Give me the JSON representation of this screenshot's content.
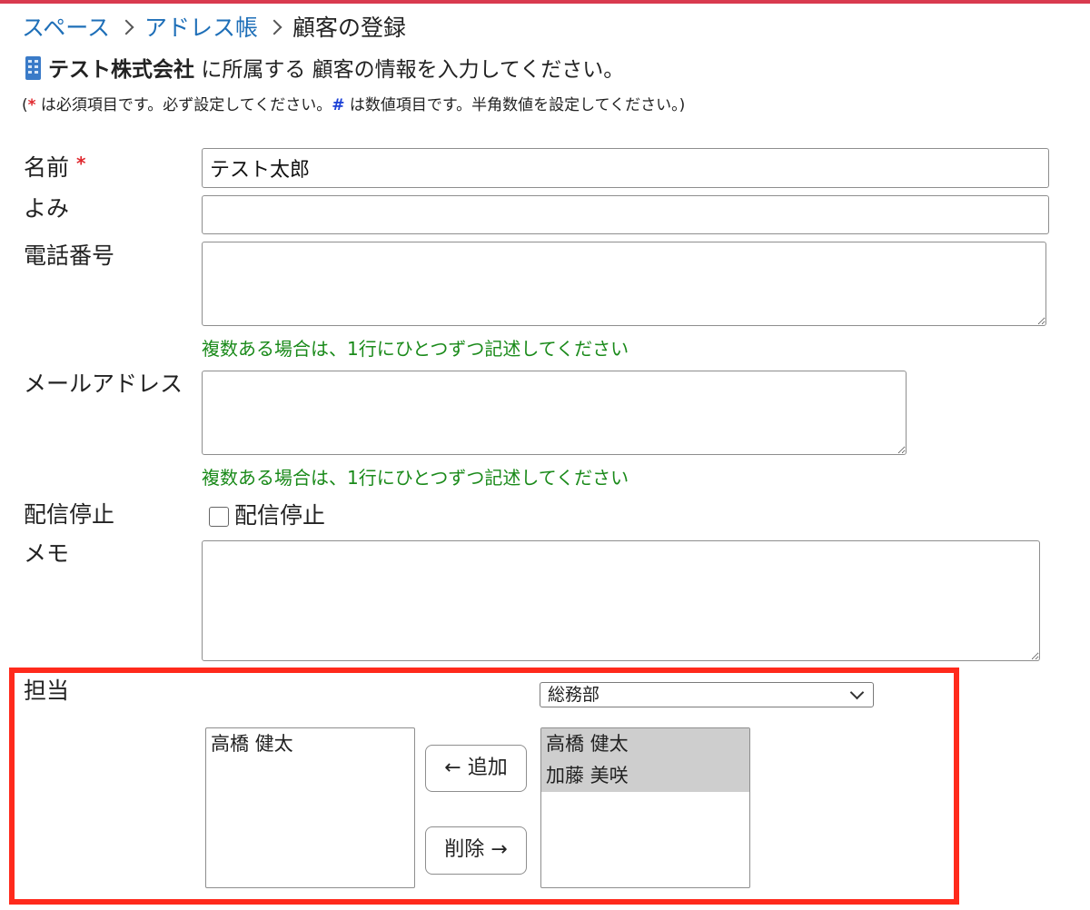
{
  "breadcrumb": {
    "items": [
      "スペース",
      "アドレス帳"
    ],
    "current": "顧客の登録"
  },
  "heading": {
    "company": "テスト株式会社",
    "text": "に所属する 顧客の情報を入力してください。"
  },
  "note": {
    "open": "(",
    "star": "*",
    "required_text": " は必須項目です。必ず設定してください。",
    "hash": "#",
    "numeric_text": " は数値項目です。半角数値を設定してください。)"
  },
  "form": {
    "name": {
      "label": "名前",
      "required_mark": "*",
      "value": "テスト太郎"
    },
    "yomi": {
      "label": "よみ",
      "value": ""
    },
    "phone": {
      "label": "電話番号",
      "value": "",
      "hint": "複数ある場合は、1行にひとつずつ記述してください"
    },
    "email": {
      "label": "メールアドレス",
      "value": "",
      "hint": "複数ある場合は、1行にひとつずつ記述してください"
    },
    "unsubscribe": {
      "label": "配信停止",
      "checkbox_label": "配信停止",
      "checked": false
    },
    "memo": {
      "label": "メモ",
      "value": ""
    },
    "assignee": {
      "label": "担当",
      "department": "総務部",
      "assigned": [
        "高橋 健太"
      ],
      "candidates": [
        "高橋 健太",
        "加藤 美咲"
      ],
      "add_button": "← 追加",
      "remove_button": "削除 →"
    }
  },
  "colors": {
    "link": "#1e6fb8",
    "hint": "#1a8a1a",
    "required": "#e0282e",
    "numeric": "#1a3fd6",
    "highlight_border": "#ff2a1c",
    "top_border": "#d93a4f",
    "selected_option": "#cecece"
  },
  "icons": {
    "company": "building-icon",
    "crumb_separator": "chevron-right-icon",
    "select": "chevron-down-icon"
  }
}
